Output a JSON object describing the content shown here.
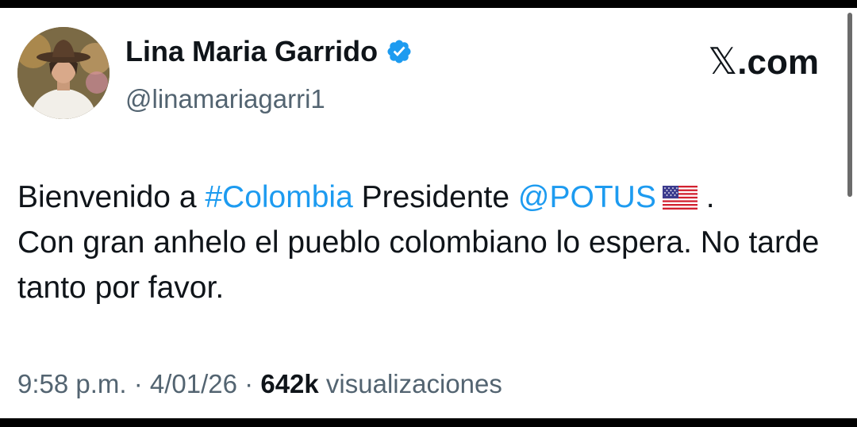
{
  "author": {
    "display_name": "Lina Maria Garrido",
    "handle": "@linamariagarri1",
    "verified_icon": "verified-badge-icon",
    "avatar_icon": "profile-avatar"
  },
  "brand": {
    "label": "X.com",
    "mark": "𝕏",
    "suffix": ".com"
  },
  "tweet": {
    "line1_prefix": "Bienvenido a ",
    "hashtag": "#Colombia",
    "line1_middle": " Presidente ",
    "mention": "@POTUS",
    "flag_icon": "us-flag-emoji",
    "line1_suffix": " .",
    "line2": "Con gran anhelo el pueblo colombiano lo espera. No tarde tanto por favor."
  },
  "meta": {
    "time": "9:58 p.m.",
    "separator": " · ",
    "date": "4/01/26",
    "views_count": "642k",
    "views_label": " visualizaciones"
  },
  "colors": {
    "link": "#1d9bf0",
    "text": "#0f1419",
    "secondary": "#536471",
    "verified": "#1d9bf0"
  }
}
